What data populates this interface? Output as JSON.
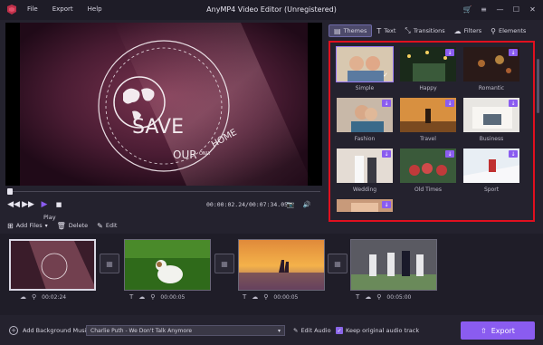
{
  "app": {
    "title": "AnyMP4 Video Editor (Unregistered)",
    "menu": [
      "File",
      "Export",
      "Help"
    ]
  },
  "preview": {
    "overlay_text_main": "SAVE",
    "overlay_text_our": "OUR",
    "overlay_text_only": "ONLY",
    "overlay_text_home": "HOME",
    "time_current": "00:00:02.24",
    "time_total": "00:07:34.05",
    "time_separator": "/",
    "play_tooltip": "Play"
  },
  "toolbar": {
    "add_files": "Add Files",
    "delete": "Delete",
    "edit": "Edit"
  },
  "timeline": {
    "clips": [
      {
        "duration": "00:02:24"
      },
      {
        "duration": "00:00:05"
      },
      {
        "duration": "00:00:05"
      },
      {
        "duration": "00:05:00"
      }
    ]
  },
  "bottom": {
    "add_bgm_label": "Add Background Music:",
    "bgm_track": "Charlie Puth - We Don't Talk Anymore",
    "edit_audio": "Edit Audio",
    "keep_original": "Keep original audio track",
    "export": "Export"
  },
  "panel": {
    "tabs": [
      {
        "label": "Themes",
        "icon": "themes-icon"
      },
      {
        "label": "Text",
        "icon": "text-icon"
      },
      {
        "label": "Transitions",
        "icon": "transitions-icon"
      },
      {
        "label": "Filters",
        "icon": "filters-icon"
      },
      {
        "label": "Elements",
        "icon": "elements-icon"
      }
    ],
    "themes": [
      {
        "label": "Simple"
      },
      {
        "label": "Happy"
      },
      {
        "label": "Romantic"
      },
      {
        "label": "Fashion"
      },
      {
        "label": "Travel"
      },
      {
        "label": "Business"
      },
      {
        "label": "Wedding"
      },
      {
        "label": "Old Times"
      },
      {
        "label": "Sport"
      },
      {
        "label": ""
      }
    ]
  },
  "colors": {
    "accent": "#8a5cf0",
    "highlight_frame": "#e0101f",
    "background": "#24222e"
  }
}
